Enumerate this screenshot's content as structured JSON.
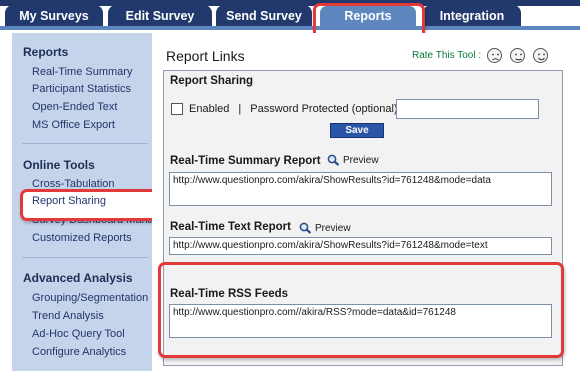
{
  "tabs": [
    {
      "label": "My Surveys"
    },
    {
      "label": "Edit Survey"
    },
    {
      "label": "Send Survey"
    },
    {
      "label": "Reports"
    },
    {
      "label": "Integration"
    }
  ],
  "sidebar": {
    "reports_heading": "Reports",
    "reports_items": [
      "Real-Time Summary",
      "Participant Statistics",
      "Open-Ended Text",
      "MS Office Export"
    ],
    "online_heading": "Online Tools",
    "online_items": [
      "Cross-Tabulation",
      "Report Sharing",
      "Survey Dashboard Manager",
      "Customized Reports"
    ],
    "advanced_heading": "Advanced Analysis",
    "advanced_items": [
      "Grouping/Segmentation",
      "Trend Analysis",
      "Ad-Hoc Query Tool",
      "Configure Analytics"
    ]
  },
  "main": {
    "title": "Report Links",
    "rate_label": "Rate This Tool :",
    "rate_icons": [
      "sad-face-icon",
      "neutral-face-icon",
      "happy-face-icon"
    ],
    "report_sharing": {
      "title": "Report Sharing",
      "enabled_label": "Enabled",
      "separator": "|",
      "password_label": "Password Protected (optional):",
      "password_value": "",
      "save_label": "Save"
    },
    "summary_report": {
      "title": "Real-Time Summary Report",
      "preview_label": "Preview",
      "url": "http://www.questionpro.com/akira/ShowResults?id=761248&mode=data"
    },
    "text_report": {
      "title": "Real-Time Text Report",
      "preview_label": "Preview",
      "url": "http://www.questionpro.com/akira/ShowResults?id=761248&mode=text"
    },
    "rss_feeds": {
      "title": "Real-Time RSS Feeds",
      "url": "http://www.questionpro.com//akira/RSS?mode=data&id=761248"
    }
  },
  "colors": {
    "tab_bg": "#22396e",
    "tab_active_bg": "#5e86bf",
    "sidebar_bg": "#c5d4ea",
    "highlight": "#e23a3a",
    "save_button": "#2b56a8",
    "rate_label": "#0a7a3b"
  }
}
